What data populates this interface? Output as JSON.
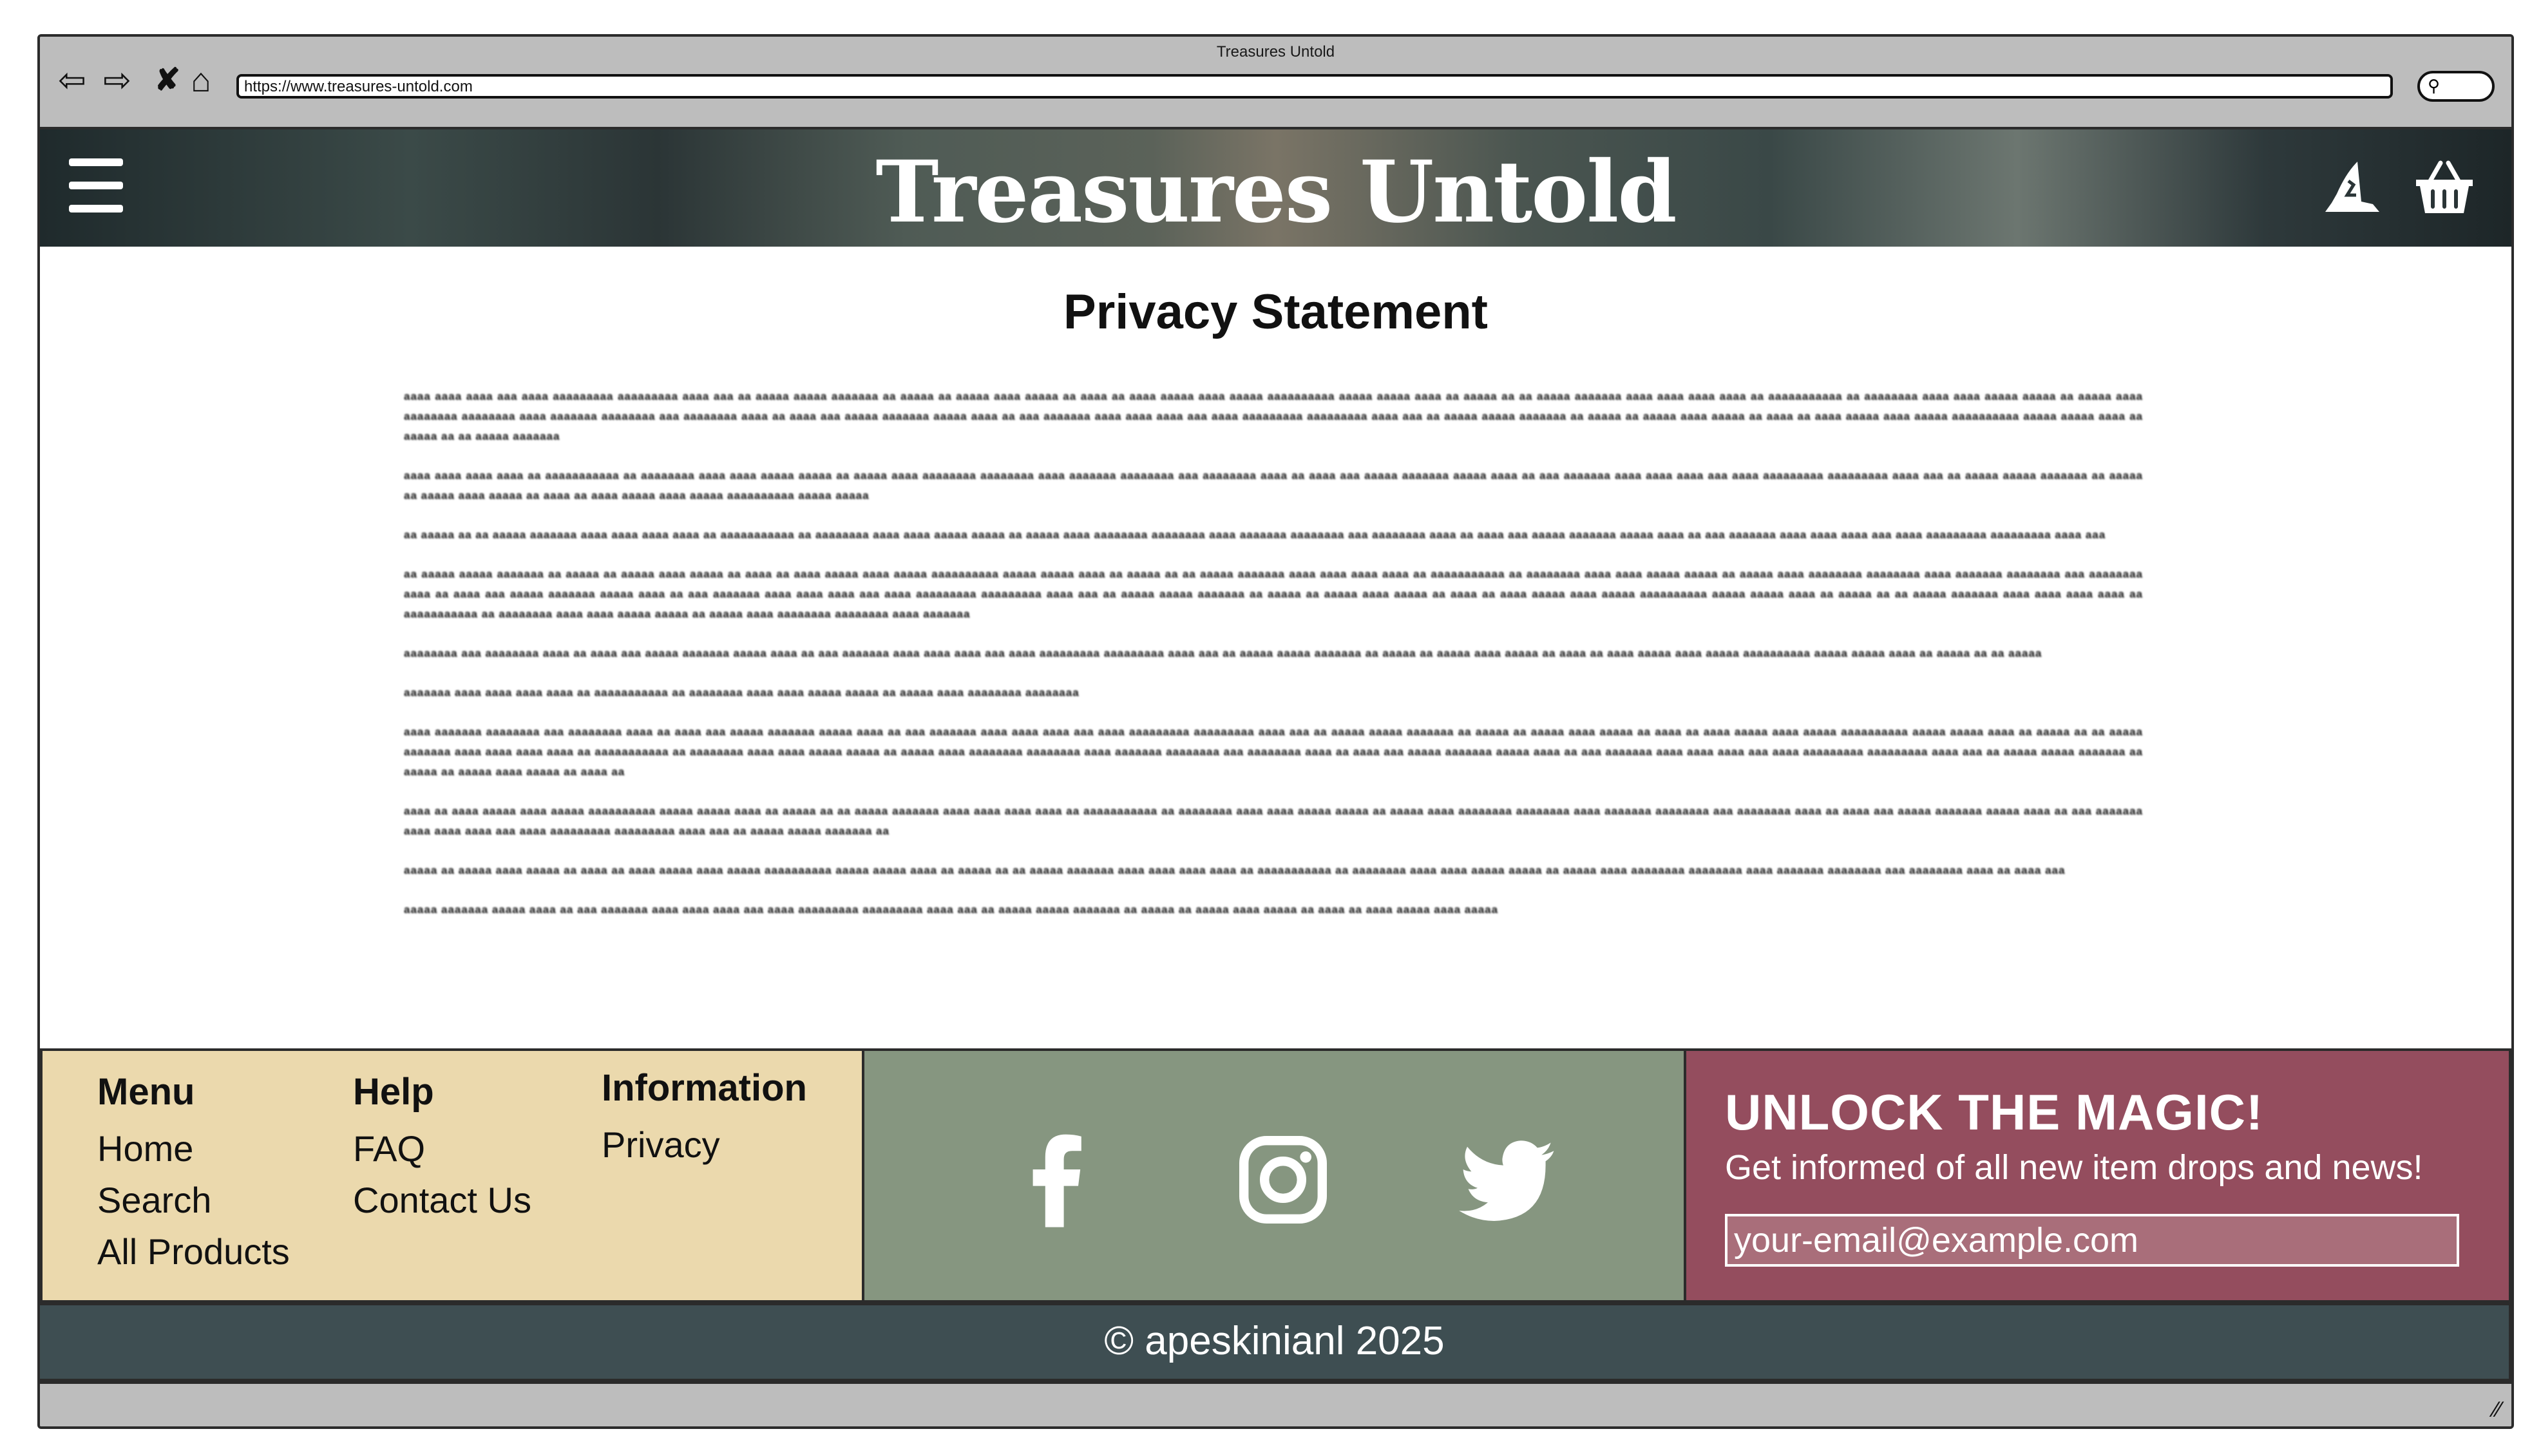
{
  "window": {
    "title": "Treasures Untold",
    "url": "https://www.treasures-untold.com"
  },
  "chrome_icons": [
    "back-icon",
    "forward-icon",
    "stop-icon",
    "home-icon",
    "search-icon"
  ],
  "header": {
    "brand": "Treasures Untold",
    "menu_icon": "hamburger-icon",
    "account_icon": "wizard-hat-icon",
    "cart_icon": "basket-icon"
  },
  "main": {
    "title": "Privacy Statement",
    "paragraphs": [
      "aaaa aaaa aaaa aaa aaaa aaaaaaaaa aaaaaaaaa aaaa aaa aa aaaaa aaaaa aaaaaaa aa aaaaa aa aaaaa aaaa aaaaa aa aaaa aa aaaa aaaaa aaaa aaaaa aaaaaaaaaa aaaaa aaaaa aaaa aa aaaaa aa aa aaaaa aaaaaaa aaaa aaaa aaaa aaaa aa aaaaaaaaaaa aa aaaaaaaa aaaa aaaa aaaaa aaaaa aa aaaaa aaaa aaaaaaaa aaaaaaaa aaaa aaaaaaa aaaaaaaa aaa aaaaaaaa aaaa aa aaaa aaa aaaaa aaaaaaa aaaaa aaaa aa aaa aaaaaaa aaaa aaaa aaaa aaa aaaa aaaaaaaaa aaaaaaaaa aaaa aaa aa aaaaa aaaaa aaaaaaa aa aaaaa aa aaaaa aaaa aaaaa aa aaaa aa aaaa aaaaa aaaa aaaaa aaaaaaaaaa aaaaa aaaaa aaaa aa aaaaa aa aa aaaaa aaaaaaa",
      "aaaa aaaa aaaa aaaa aa aaaaaaaaaaa aa aaaaaaaa aaaa aaaa aaaaa aaaaa aa aaaaa aaaa aaaaaaaa aaaaaaaa aaaa aaaaaaa aaaaaaaa aaa aaaaaaaa aaaa aa aaaa aaa aaaaa aaaaaaa aaaaa aaaa aa aaa aaaaaaa aaaa aaaa aaaa aaa aaaa aaaaaaaaa aaaaaaaaa aaaa aaa aa aaaaa aaaaa aaaaaaa aa aaaaa aa aaaaa aaaa aaaaa aa aaaa aa aaaa aaaaa aaaa aaaaa aaaaaaaaaa aaaaa aaaaa",
      "aa aaaaa aa aa aaaaa aaaaaaa aaaa aaaa aaaa aaaa aa aaaaaaaaaaa aa aaaaaaaa aaaa aaaa aaaaa aaaaa aa aaaaa aaaa aaaaaaaa aaaaaaaa aaaa aaaaaaa aaaaaaaa aaa aaaaaaaa aaaa aa aaaa aaa aaaaa aaaaaaa aaaaa aaaa aa aaa aaaaaaa aaaa aaaa aaaa aaa aaaa aaaaaaaaa aaaaaaaaa aaaa aaa",
      "aa aaaaa aaaaa aaaaaaa aa aaaaa aa aaaaa aaaa aaaaa aa aaaa aa aaaa aaaaa aaaa aaaaa aaaaaaaaaa aaaaa aaaaa aaaa aa aaaaa aa aa aaaaa aaaaaaa aaaa aaaa aaaa aaaa aa aaaaaaaaaaa aa aaaaaaaa aaaa aaaa aaaaa aaaaa aa aaaaa aaaa aaaaaaaa aaaaaaaa aaaa aaaaaaa aaaaaaaa aaa aaaaaaaa aaaa aa aaaa aaa aaaaa aaaaaaa aaaaa aaaa aa aaa aaaaaaa aaaa aaaa aaaa aaa aaaa aaaaaaaaa aaaaaaaaa aaaa aaa aa aaaaa aaaaa aaaaaaa aa aaaaa aa aaaaa aaaa aaaaa aa aaaa aa aaaa aaaaa aaaa aaaaa aaaaaaaaaa aaaaa aaaaa aaaa aa aaaaa aa aa aaaaa aaaaaaa aaaa aaaa aaaa aaaa aa aaaaaaaaaaa aa aaaaaaaa aaaa aaaa aaaaa aaaaa aa aaaaa aaaa aaaaaaaa aaaaaaaa aaaa aaaaaaa",
      "aaaaaaaa aaa aaaaaaaa aaaa aa aaaa aaa aaaaa aaaaaaa aaaaa aaaa aa aaa aaaaaaa aaaa aaaa aaaa aaa aaaa aaaaaaaaa aaaaaaaaa aaaa aaa aa aaaaa aaaaa aaaaaaa aa aaaaa aa aaaaa aaaa aaaaa aa aaaa aa aaaa aaaaa aaaa aaaaa aaaaaaaaaa aaaaa aaaaa aaaa aa aaaaa aa aa aaaaa",
      "aaaaaaa aaaa aaaa aaaa aaaa aa aaaaaaaaaaa aa aaaaaaaa aaaa aaaa aaaaa aaaaa aa aaaaa aaaa aaaaaaaa aaaaaaaa",
      "aaaa aaaaaaa aaaaaaaa aaa aaaaaaaa aaaa aa aaaa aaa aaaaa aaaaaaa aaaaa aaaa aa aaa aaaaaaa aaaa aaaa aaaa aaa aaaa aaaaaaaaa aaaaaaaaa aaaa aaa aa aaaaa aaaaa aaaaaaa aa aaaaa aa aaaaa aaaa aaaaa aa aaaa aa aaaa aaaaa aaaa aaaaa aaaaaaaaaa aaaaa aaaaa aaaa aa aaaaa aa aa aaaaa aaaaaaa aaaa aaaa aaaa aaaa aa aaaaaaaaaaa aa aaaaaaaa aaaa aaaa aaaaa aaaaa aa aaaaa aaaa aaaaaaaa aaaaaaaa aaaa aaaaaaa aaaaaaaa aaa aaaaaaaa aaaa aa aaaa aaa aaaaa aaaaaaa aaaaa aaaa aa aaa aaaaaaa aaaa aaaa aaaa aaa aaaa aaaaaaaaa aaaaaaaaa aaaa aaa aa aaaaa aaaaa aaaaaaa aa aaaaa aa aaaaa aaaa aaaaa aa aaaa aa",
      "aaaa aa aaaa aaaaa aaaa aaaaa aaaaaaaaaa aaaaa aaaaa aaaa aa aaaaa aa aa aaaaa aaaaaaa aaaa aaaa aaaa aaaa aa aaaaaaaaaaa aa aaaaaaaa aaaa aaaa aaaaa aaaaa aa aaaaa aaaa aaaaaaaa aaaaaaaa aaaa aaaaaaa aaaaaaaa aaa aaaaaaaa aaaa aa aaaa aaa aaaaa aaaaaaa aaaaa aaaa aa aaa aaaaaaa aaaa aaaa aaaa aaa aaaa aaaaaaaaa aaaaaaaaa aaaa aaa aa aaaaa aaaaa aaaaaaa aa",
      "aaaaa aa aaaaa aaaa aaaaa aa aaaa aa aaaa aaaaa aaaa aaaaa aaaaaaaaaa aaaaa aaaaa aaaa aa aaaaa aa aa aaaaa aaaaaaa aaaa aaaa aaaa aaaa aa aaaaaaaaaaa aa aaaaaaaa aaaa aaaa aaaaa aaaaa aa aaaaa aaaa aaaaaaaa aaaaaaaa aaaa aaaaaaa aaaaaaaa aaa aaaaaaaa aaaa aa aaaa aaa",
      "aaaaa aaaaaaa aaaaa aaaa aa aaa aaaaaaa aaaa aaaa aaaa aaa aaaa aaaaaaaaa aaaaaaaaa aaaa aaa aa aaaaa aaaaa aaaaaaa aa aaaaa aa aaaaa aaaa aaaaa aa aaaa aa aaaa aaaaa aaaa aaaaa"
    ]
  },
  "footer": {
    "menu": {
      "heading": "Menu",
      "links": [
        "Home",
        "Search",
        "All Products"
      ]
    },
    "help": {
      "heading": "Help",
      "links": [
        "FAQ",
        "Contact Us"
      ]
    },
    "information": {
      "heading": "Information",
      "links": [
        "Privacy"
      ]
    },
    "social": [
      "facebook-icon",
      "instagram-icon",
      "twitter-icon"
    ],
    "newsletter": {
      "title": "UNLOCK THE MAGIC!",
      "subtitle": "Get informed of all new item drops and news!",
      "placeholder": "your-email@example.com"
    },
    "copyright": "© apeskinianl 2025"
  },
  "colors": {
    "menu_bg": "#ebd9ad",
    "social_bg": "#869680",
    "newsletter_bg": "#944d5e",
    "copyright_bg": "#3e4e52"
  }
}
